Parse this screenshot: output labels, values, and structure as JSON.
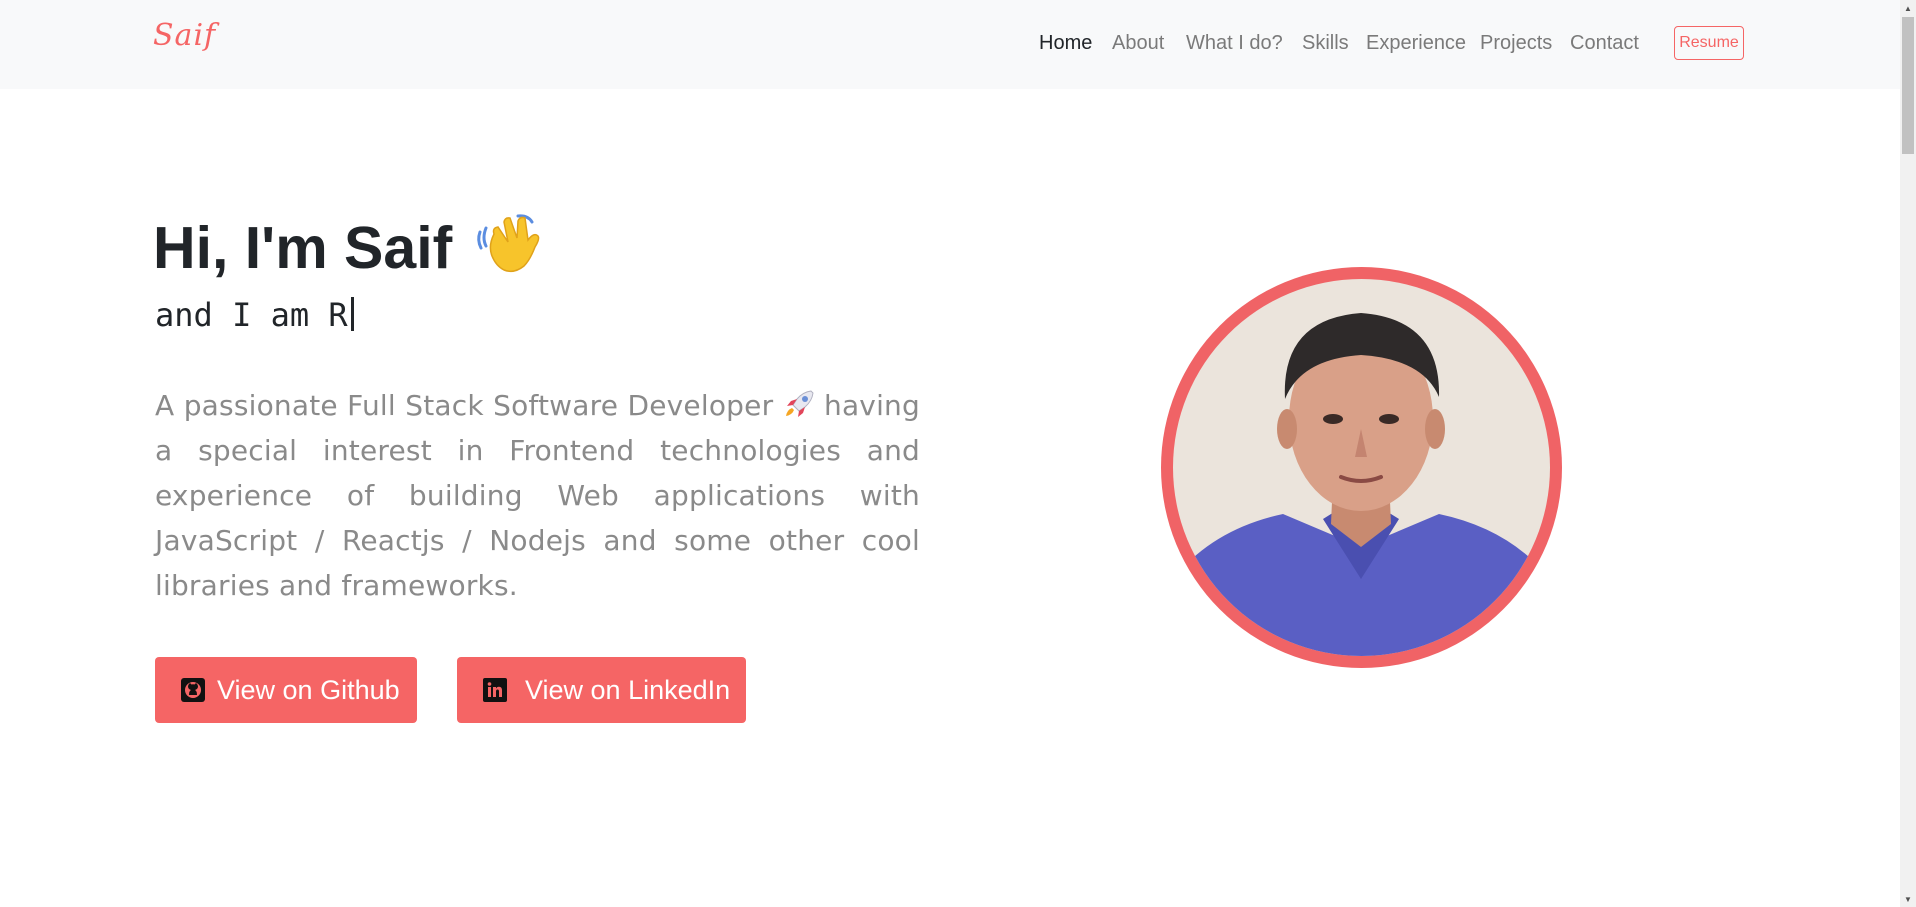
{
  "navbar": {
    "brand": "Saif",
    "links": [
      {
        "label": "Home",
        "active": true
      },
      {
        "label": "About"
      },
      {
        "label": "What I do?"
      },
      {
        "label": "Skills"
      },
      {
        "label": "Experience"
      },
      {
        "label": "Projects"
      },
      {
        "label": "Contact"
      }
    ],
    "resume_label": "Resume"
  },
  "hero": {
    "greeting": "Hi, I'm Saif",
    "typed_prefix": "and I am R",
    "intro_before_icon": "A passionate Full Stack Software Developer",
    "intro_after_icon": "having a special interest in Frontend technologies and experience of building Web applications with JavaScript / Reactjs / Nodejs and some other cool libraries and frameworks.",
    "github_button": "View on Github",
    "linkedin_button": "View on LinkedIn"
  },
  "icons": {
    "wave": "waving-hand-icon",
    "rocket": "rocket-icon",
    "github": "github-icon",
    "linkedin": "linkedin-icon"
  },
  "colors": {
    "accent": "#f56565",
    "nav_bg": "#f8f9fa",
    "heading": "#212529",
    "body_text": "#8a8a8a"
  }
}
